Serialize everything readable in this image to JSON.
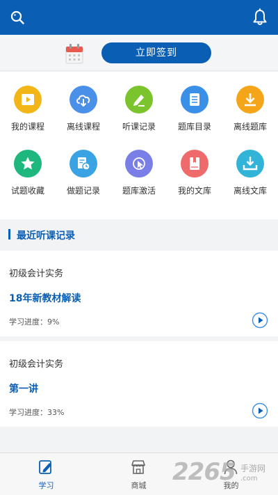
{
  "header": {
    "search_icon": "search-icon",
    "bell_icon": "bell-icon",
    "background": "#0a5fb4"
  },
  "signin": {
    "calendar_icon": "calendar-icon",
    "button_label": "立即签到"
  },
  "grid": {
    "items": [
      {
        "label": "我的课程",
        "icon": "play-video-icon",
        "color": "#f2b619"
      },
      {
        "label": "离线课程",
        "icon": "cloud-download-icon",
        "color": "#4a8fe8"
      },
      {
        "label": "听课记录",
        "icon": "pencil-icon",
        "color": "#7cc42e"
      },
      {
        "label": "题库目录",
        "icon": "list-document-icon",
        "color": "#3a8fe6"
      },
      {
        "label": "离线题库",
        "icon": "download-icon",
        "color": "#f4a51a"
      },
      {
        "label": "试题收藏",
        "icon": "star-icon",
        "color": "#1eb77e"
      },
      {
        "label": "做题记录",
        "icon": "document-clock-icon",
        "color": "#3aa3e3"
      },
      {
        "label": "题库激活",
        "icon": "cursor-click-icon",
        "color": "#7a7fe8"
      },
      {
        "label": "我的文库",
        "icon": "book-icon",
        "color": "#ef6b6b"
      },
      {
        "label": "离线文库",
        "icon": "tray-download-icon",
        "color": "#32b4d8"
      }
    ]
  },
  "recent": {
    "title": "最近听课记录",
    "cards": [
      {
        "subject": "初级会计实务",
        "lesson": "18年新教材解读",
        "progress": "学习进度：9%"
      },
      {
        "subject": "初级会计实务",
        "lesson": "第一讲",
        "progress": "学习进度：33%"
      }
    ]
  },
  "tabbar": {
    "tabs": [
      {
        "label": "学习",
        "icon": "edit-icon",
        "active": true
      },
      {
        "label": "商城",
        "icon": "store-icon",
        "active": false
      },
      {
        "label": "我的",
        "icon": "user-icon",
        "active": false
      }
    ],
    "active_color": "#0a5fb4"
  },
  "watermark": {
    "number": "2265",
    "site": "手游网",
    "domain": ".com"
  }
}
